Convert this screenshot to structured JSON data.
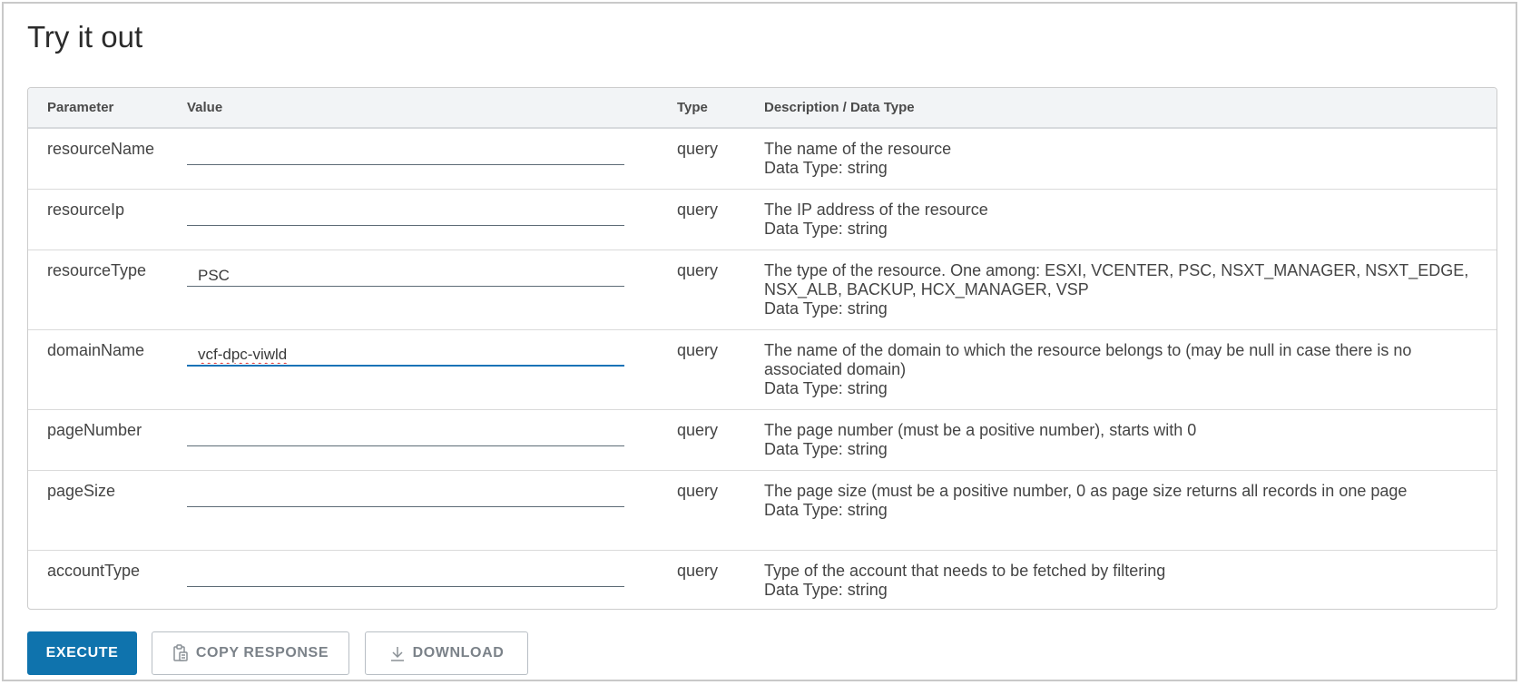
{
  "page": {
    "title": "Try it out"
  },
  "table": {
    "headers": {
      "parameter": "Parameter",
      "value": "Value",
      "type": "Type",
      "description": "Description / Data Type"
    },
    "rows": [
      {
        "name": "resourceName",
        "value": "",
        "type": "query",
        "desc": [
          "The name of the resource",
          "Data Type: string"
        ]
      },
      {
        "name": "resourceIp",
        "value": "",
        "type": "query",
        "desc": [
          "The IP address of the resource",
          "Data Type: string"
        ]
      },
      {
        "name": "resourceType",
        "value": "PSC",
        "type": "query",
        "desc": [
          "The type of the resource. One among: ESXI, VCENTER, PSC, NSXT_MANAGER, NSXT_EDGE, NSX_ALB, BACKUP, HCX_MANAGER, VSP",
          "Data Type: string"
        ]
      },
      {
        "name": "domainName",
        "value": "vcf-dpc-viwld",
        "type": "query",
        "desc": [
          "The name of the domain to which the resource belongs to (may be null in case there is no associated domain)",
          "Data Type: string"
        ]
      },
      {
        "name": "pageNumber",
        "value": "",
        "type": "query",
        "desc": [
          "The page number (must be a positive number), starts with 0",
          "Data Type: string"
        ]
      },
      {
        "name": "pageSize",
        "value": "",
        "type": "query",
        "desc": [
          "The page size (must be a positive number, 0 as page size returns all records in one page",
          "Data Type: string"
        ]
      },
      {
        "name": "accountType",
        "value": "",
        "type": "query",
        "desc": [
          "Type of the account that needs to be fetched by filtering",
          "Data Type: string"
        ]
      }
    ]
  },
  "actions": {
    "execute": "EXECUTE",
    "copy_response": "COPY RESPONSE",
    "copy_icon": "clipboard-icon",
    "download": "DOWNLOAD",
    "download_icon": "download-icon"
  },
  "colors": {
    "primary": "#0f73ad",
    "focus_underline": "#1a73b7"
  }
}
